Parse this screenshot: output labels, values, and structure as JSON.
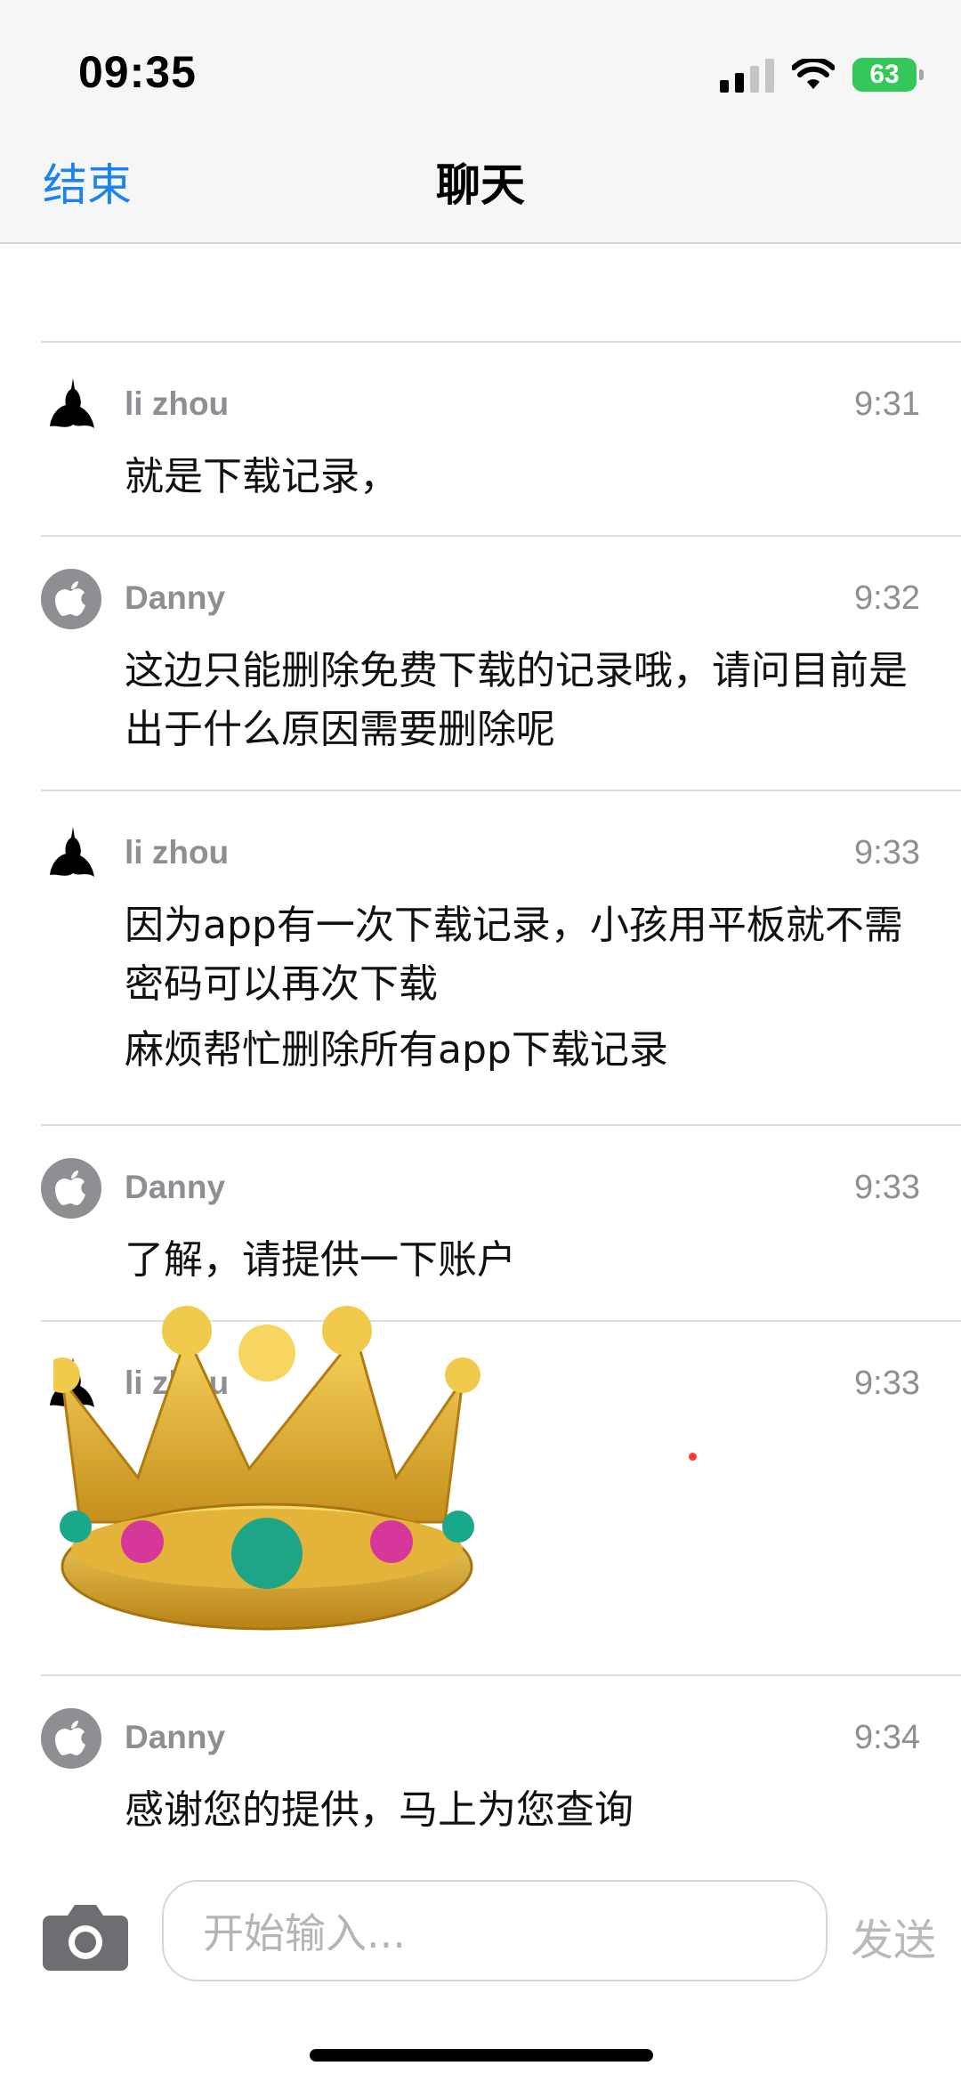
{
  "status_bar": {
    "time": "09:35",
    "battery": "63"
  },
  "nav": {
    "end_label": "结束",
    "title": "聊天"
  },
  "messages": [
    {
      "sender": "li zhou",
      "time": "9:31",
      "lines": [
        "就是下载记录，"
      ]
    },
    {
      "sender": "Danny",
      "time": "9:32",
      "lines": [
        "这边只能删除免费下载的记录哦，请问目前是出于什么原因需要删除呢"
      ]
    },
    {
      "sender": "li zhou",
      "time": "9:33",
      "lines": [
        "因为app有一次下载记录，小孩用平板就不需密码可以再次下载",
        "麻烦帮忙删除所有app下载记录"
      ]
    },
    {
      "sender": "Danny",
      "time": "9:33",
      "lines": [
        "了解，请提供一下账户"
      ]
    },
    {
      "sender": "li zhou",
      "time": "9:33",
      "lines": []
    },
    {
      "sender": "Danny",
      "time": "9:34",
      "lines": [
        "感谢您的提供，马上为您查询"
      ]
    }
  ],
  "composer": {
    "placeholder": "开始输入...",
    "send_label": "发送"
  },
  "icons": {
    "camera": "camera-icon",
    "apple": "apple-logo-icon",
    "avatar": "user-avatar-icon",
    "crown": "crown-sticker"
  },
  "colors": {
    "accent": "#1b82f5",
    "secondary": "#8e8e93"
  }
}
